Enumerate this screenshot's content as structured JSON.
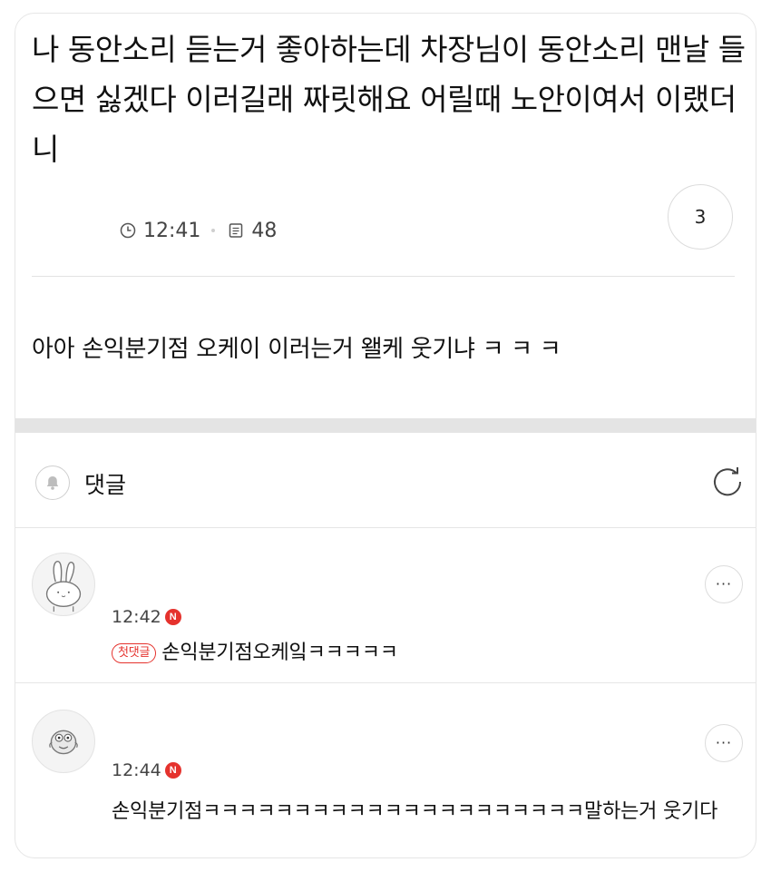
{
  "post": {
    "title": "나 동안소리 듣는거 좋아하는데 차장님이 동안소리 맨날 들으면 싫겠다 이러길래 짜릿해요 어릴때 노안이여서 이랬더니",
    "time": "12:41",
    "views": "48",
    "comment_count": "3",
    "body": "아아 손익분기점 오케이 이러는거 왤케 웃기냐 ㅋ ㅋ ㅋ",
    "icons": {
      "time": "clock-icon",
      "views": "document-icon"
    }
  },
  "comments_section": {
    "title": "댓글",
    "icons": {
      "bell": "bell-icon",
      "refresh": "refresh-icon"
    }
  },
  "comments": [
    {
      "time": "12:42",
      "new_badge": "N",
      "first_badge": "첫댓글",
      "text": "손익분기점오케잌ㅋㅋㅋㅋㅋ",
      "more": "···",
      "avatar": "rabbit-avatar"
    },
    {
      "time": "12:44",
      "new_badge": "N",
      "text": "손익분기점ㅋㅋㅋㅋㅋㅋㅋㅋㅋㅋㅋㅋㅋㅋㅋㅋㅋㅋㅋㅋㅋ말하는거 웃기다",
      "more": "···",
      "avatar": "creature-avatar"
    }
  ],
  "colors": {
    "accent_red": "#e5322d",
    "divider": "#e6e6e6",
    "section_gap": "#e4e4e4",
    "text": "#111111",
    "meta_text": "#444444"
  }
}
